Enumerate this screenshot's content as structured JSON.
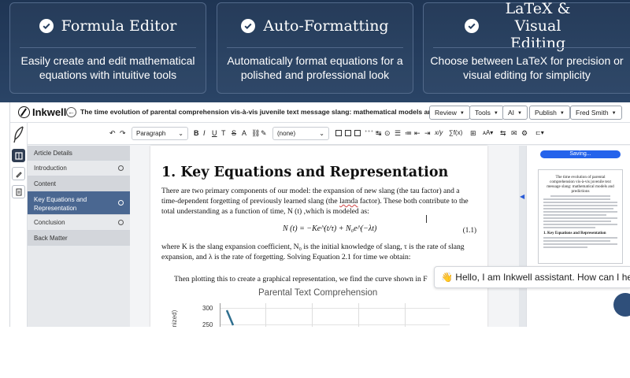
{
  "features": [
    {
      "title": "Formula Editor",
      "description": "Easily create and edit mathematical equations with intuitive tools"
    },
    {
      "title": "Auto-Formatting",
      "description": "Automatically format equations for a polished and professional look"
    },
    {
      "title": "LaTeX & Visual Editing",
      "description": "Choose between LaTeX for precision or visual editing for simplicity"
    }
  ],
  "app": {
    "brand": "Inkwell",
    "document_title": "The time evolution of parental comprehension vis-à-vis juvenile text message slang: mathematical models and predictions",
    "menus": [
      "Review",
      "Tools",
      "AI",
      "Publish",
      "Fred Smith"
    ]
  },
  "toolbar": {
    "block_style": "Paragraph",
    "style_select": "(none)",
    "format_buttons": [
      "B",
      "I",
      "U",
      "T",
      "S",
      "A"
    ]
  },
  "outline": {
    "items": [
      {
        "label": "Article Details",
        "type": "header"
      },
      {
        "label": "Introduction",
        "type": "item"
      },
      {
        "label": "Content",
        "type": "header"
      },
      {
        "label": "Key Equations and Representation",
        "type": "active"
      },
      {
        "label": "Conclusion",
        "type": "item"
      },
      {
        "label": "Back Matter",
        "type": "header"
      }
    ]
  },
  "document": {
    "heading": "1. Key Equations and Representation",
    "para1_a": "There are two primary components of our model: the expansion of new slang (the tau factor) and a time-dependent forgetting of previously learned slang (the ",
    "para1_misspelled": "lamda",
    "para1_b": " factor). These both contribute to the total understanding as a function of time, N (t) ,which is modeled as:",
    "equation": "N (t) = −Ke^(t/τ) + N₀e^(−λt)",
    "equation_number": "(1.1)",
    "para2": "where K is the slang expansion coefficient, N₀ is the initial knowledge of slang, τ is the rate of slang expansion, and λ is the rate of forgetting. Solving Equation 2.1 for time we obtain:",
    "para3": "Then plotting this to create a graphical representation, we find the curve shown in F",
    "chart_title": "Parental Text Comprehension",
    "chart_ylabel": "gnized)",
    "chart_yticks": [
      "300",
      "250"
    ]
  },
  "preview": {
    "saving_label": "Saving...",
    "thumb_title": "The time evolution of parental comprehension vis-à-vis juvenile text message slang: mathematical models and predictions",
    "thumb_heading": "1. Key Equations and Representation"
  },
  "assistant": {
    "greeting": "👋 Hello, I am Inkwell assistant. How can I help?"
  },
  "colors": {
    "hero_bg": "#253d5e",
    "accent": "#2563eb",
    "outline_active": "#4a6791"
  }
}
